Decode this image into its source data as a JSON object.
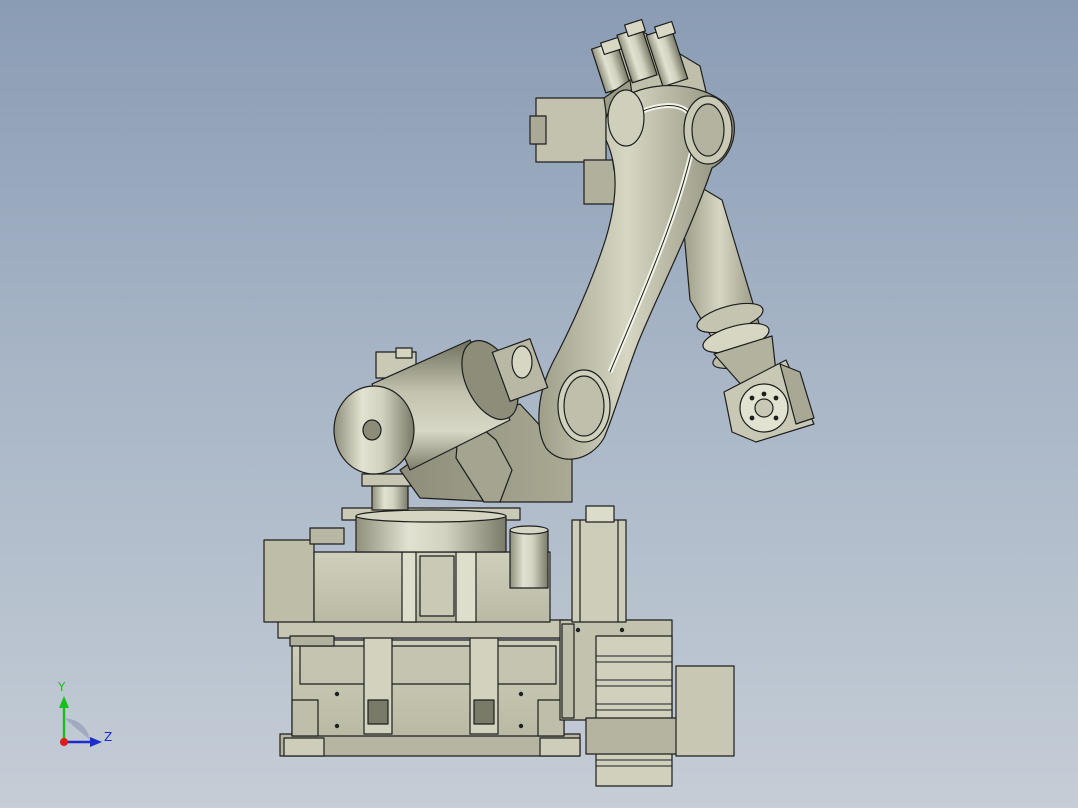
{
  "viewport": {
    "background_top": "#8a9cb4",
    "background_bottom": "#c5cdd6",
    "part_color": "#c9c9b4",
    "edge_color": "#1e1e1e"
  },
  "triad": {
    "y_label": "Y",
    "z_label": "Z",
    "y_color": "#18c01e",
    "z_color": "#1c2bd0",
    "origin_color": "#e11b1b"
  }
}
